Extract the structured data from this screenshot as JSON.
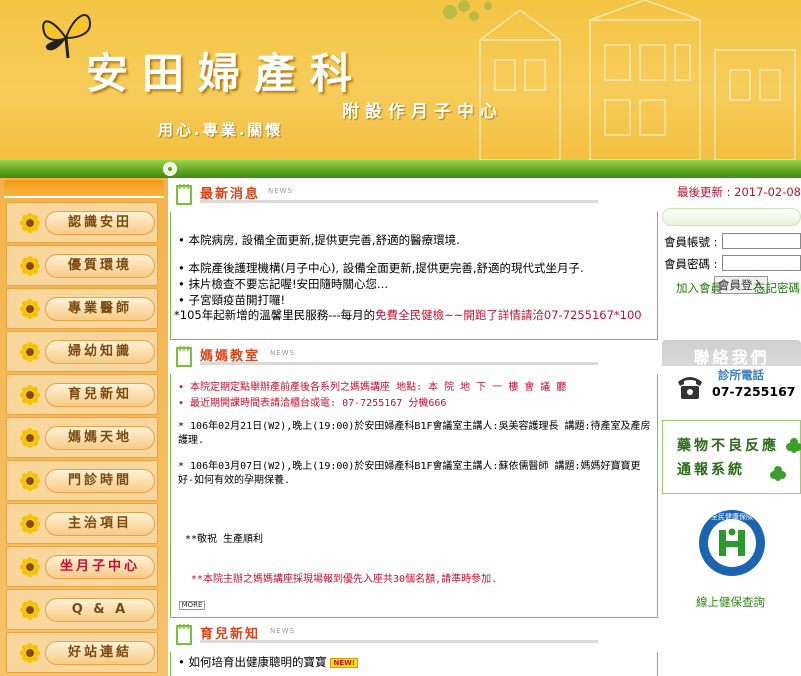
{
  "header": {
    "title": "安田婦產科",
    "subtitle": "附設作月子中心",
    "slogan": "用心.專業.關懷"
  },
  "sidebar": {
    "items": [
      {
        "label": "認識安田"
      },
      {
        "label": "優質環境"
      },
      {
        "label": "專業醫師"
      },
      {
        "label": "婦幼知識"
      },
      {
        "label": "育兒新知"
      },
      {
        "label": "媽媽天地"
      },
      {
        "label": "門診時間"
      },
      {
        "label": "主治項目"
      },
      {
        "label": "坐月子中心"
      },
      {
        "label": "Q & A"
      },
      {
        "label": "好站連結"
      }
    ]
  },
  "latest_news": {
    "title": "最新消息",
    "tag": "NEWS",
    "items": [
      "本院病房, 設備全面更新,提供更完善,舒適的醫療環境.",
      "本院產後護理機構(月子中心), 設備全面更新,提供更完善,舒適的現代式坐月子.",
      "抹片檢查不要忘記喔!安田隨時關心您...",
      "子宮頸疫苗開打囉!"
    ],
    "promo_prefix": "*105年起新增的溫馨里民服務---每月的",
    "promo_highlight": "免費全民健檢~~開跑了詳情請洽07-7255167*100"
  },
  "mom_corner": {
    "title": "媽媽教室",
    "tag": "NEWS",
    "notice1": "本院定期定點舉辦產前產後各系列之媽媽講座 地點: 本 院 地 下 一 樓 會 議 廳",
    "notice2": "最近期開課時間表請洽櫃台或電: 07-7255167 分機666",
    "event1": "* 106年02月21日(W2),晚上(19:00)於安田婦產科B1F會議室主講人:吳美容護理長 講題:待產室及產房護理.",
    "event2": "* 106年03月07日(W2),晚上(19:00)於安田婦產科B1F會議室主講人:蘇依儒醫師  講題:媽媽好寶寶更好-如何有效的孕期保養.",
    "wish": "**敬祝 生產順利",
    "footnote": "**本院主辦之媽媽講座採現場報到優先入座共30個名額,請準時參加.",
    "more": "MORE"
  },
  "parenting": {
    "title": "育兒新知",
    "tag": "NEWS",
    "items": [
      "如何培育出健康聰明的寶寶"
    ],
    "new_badge": "NEW!"
  },
  "right": {
    "last_update": "最後更新 : 2017-02-08",
    "login": {
      "account_label": "會員帳號 :",
      "password_label": "會員密碼 :",
      "account_value": "",
      "password_value": "",
      "login_button": "會員登入",
      "join_link": "加入會員",
      "forgot_link": "忘記密碼"
    },
    "contact": {
      "title": "聯絡我們",
      "label": "診所電話",
      "phone": "07-7255167"
    },
    "adr": {
      "line1": "藥物不良反應",
      "line2": "通報系統"
    },
    "nhi": {
      "logo_top": "全民健康保險",
      "logo_bottom": "NATIONAL HEALTH INSURANCE",
      "link": "線上健保查詢"
    }
  },
  "colors": {
    "header_yellow": "#f4c443",
    "green": "#5ea61f",
    "accent_red": "#c8102e",
    "nav_orange": "#f4b349"
  }
}
